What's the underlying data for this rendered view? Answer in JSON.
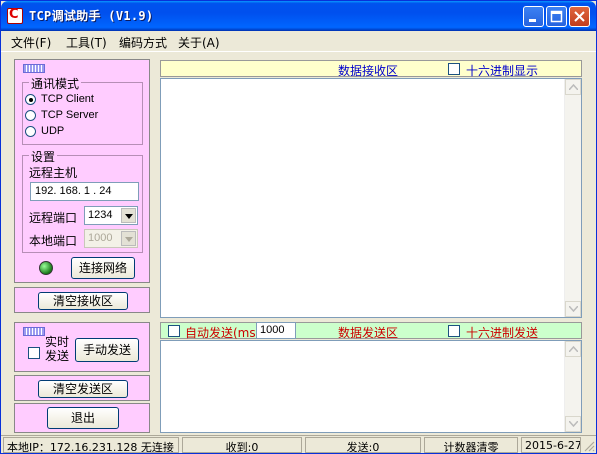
{
  "window": {
    "title": "TCP调试助手 (V1.9)"
  },
  "menu": [
    {
      "label": "文件(F)"
    },
    {
      "label": "工具(T)"
    },
    {
      "label": "编码方式"
    },
    {
      "label": "关于(A)"
    }
  ],
  "mode": {
    "title": "通讯模式",
    "options": [
      {
        "label": "TCP Client",
        "selected": true
      },
      {
        "label": "TCP Server",
        "selected": false
      },
      {
        "label": "UDP",
        "selected": false
      }
    ]
  },
  "settings": {
    "title": "设置",
    "remote_host_label": "远程主机",
    "remote_host_value": "192. 168. 1 . 24",
    "remote_port_label": "远程端口",
    "remote_port_value": "1234",
    "local_port_label": "本地端口",
    "local_port_value": "1000",
    "connect_label": "连接网络",
    "led_color": "#1a7a1a"
  },
  "buttons": {
    "clear_recv": "清空接收区",
    "realtime_send": "实时\n发送",
    "realtime_send_line1": "实时",
    "realtime_send_line2": "发送",
    "manual_send": "手动发送",
    "clear_send": "清空发送区",
    "exit": "退出"
  },
  "receive": {
    "title": "数据接收区",
    "hex_display": "十六进制显示",
    "title_color": "#0000cc"
  },
  "send": {
    "auto_send": "自动发送(ms)",
    "interval": "1000",
    "title": "数据发送区",
    "hex_send": "十六进制发送",
    "title_color": "#cc0000"
  },
  "status": {
    "local_ip": "本地IP：172.16.231.128 无连接",
    "received": "收到:0",
    "sent": "发送:0",
    "counter_clear": "计数器清零",
    "date": "2015-6-27"
  },
  "colors": {
    "left_panel": "#ffccff",
    "recv_header": "#ffffcc",
    "send_header": "#ccffcc",
    "titlebar": "#0053ee"
  }
}
